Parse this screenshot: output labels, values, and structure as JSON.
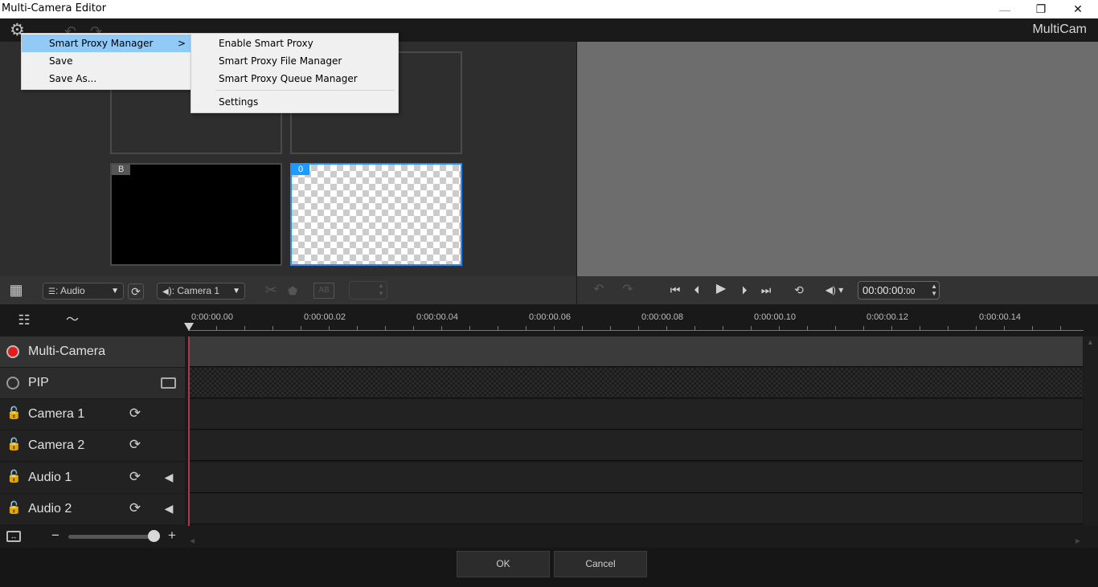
{
  "window": {
    "title": "Multi-Camera Editor",
    "controls": {
      "minimize": "—",
      "restore": "❐",
      "close": "✕"
    }
  },
  "app_toolbar": {
    "brand": "MultiCam",
    "icons": {
      "settings": "gear-icon",
      "undo": "undo-icon",
      "redo": "redo-icon"
    }
  },
  "settings_menu": {
    "items": [
      {
        "label": "Smart Proxy Manager",
        "has_submenu": true,
        "highlighted": true,
        "submenu_arrow": ">"
      },
      {
        "label": "Save"
      },
      {
        "label": "Save As..."
      }
    ]
  },
  "smart_proxy_submenu": {
    "items": [
      {
        "label": "Enable Smart Proxy"
      },
      {
        "label": "Smart Proxy File Manager"
      },
      {
        "label": "Smart Proxy Queue Manager"
      },
      {
        "label": "Settings"
      }
    ]
  },
  "camera_grid": {
    "slots": [
      {
        "tag": "",
        "state": "empty"
      },
      {
        "tag": "",
        "state": "empty"
      },
      {
        "tag": "B",
        "state": "black"
      },
      {
        "tag": "0",
        "state": "transparent",
        "selected": true
      }
    ]
  },
  "left_controls": {
    "layout_icon": "grid-layout-icon",
    "sync_source": {
      "prefix": ":",
      "value": "Audio"
    },
    "audio_source": {
      "prefix": "):",
      "value": "Camera 1"
    },
    "arrow": "▼"
  },
  "playback": {
    "timecode": "00:00:00:",
    "timecode_frames": "00",
    "spin_up": "▲",
    "spin_down": "▼"
  },
  "ruler": {
    "labels": [
      "0:00:00.00",
      "0:00:00.02",
      "0:00:00.04",
      "0:00:00.06",
      "0:00:00.08",
      "0:00:00.10",
      "0:00:00.12",
      "0:00:00.14"
    ]
  },
  "tracks": [
    {
      "label": "Multi-Camera",
      "type": "multicam",
      "indicator": "record-dot"
    },
    {
      "label": "PIP",
      "type": "pip",
      "indicator": "circle"
    },
    {
      "label": "Camera 1",
      "type": "video",
      "locked": false
    },
    {
      "label": "Camera 2",
      "type": "video",
      "locked": false
    },
    {
      "label": "Audio 1",
      "type": "audio",
      "locked": false
    },
    {
      "label": "Audio 2",
      "type": "audio",
      "locked": false
    }
  ],
  "zoom": {
    "minus": "−",
    "plus": "+",
    "level": 1.0
  },
  "footer": {
    "ok": "OK",
    "cancel": "Cancel"
  },
  "colors": {
    "accent_blue": "#1e9bff",
    "record_red": "#e41b1b",
    "playhead": "#b0364f",
    "menu_highlight": "#91c9f7"
  }
}
